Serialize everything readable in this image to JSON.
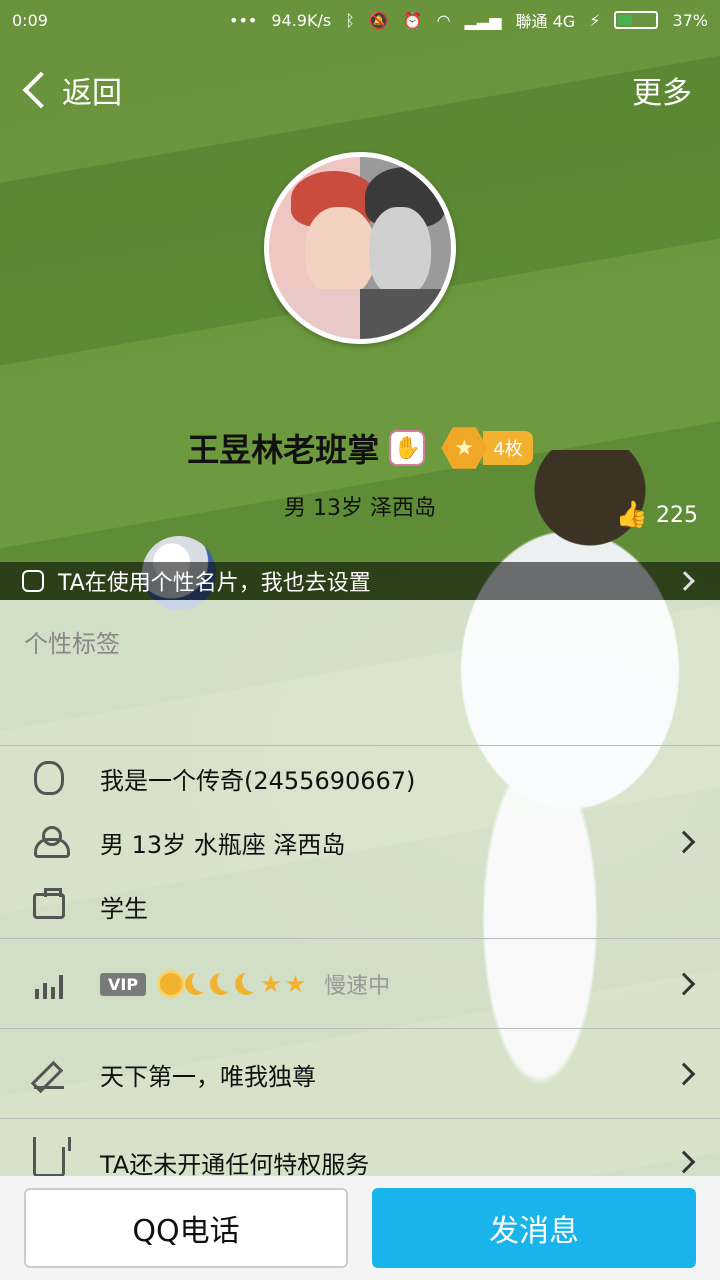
{
  "status_bar": {
    "time": "0:09",
    "speed": "94.9K/s",
    "carrier": "聯通 4G",
    "battery_pct": "37%",
    "battery_level": 0.37,
    "battery_color": "#4caf50"
  },
  "nav": {
    "back_label": "返回",
    "more_label": "更多"
  },
  "profile": {
    "name": "王昱林老班掌",
    "medal_count": "4枚",
    "summary": "男 13岁 泽西岛",
    "likes": "225"
  },
  "banner": {
    "text": "TA在使用个性名片，我也去设置"
  },
  "tags": {
    "title": "个性标签"
  },
  "info_rows": [
    {
      "icon": "qq-icon",
      "text": "我是一个传奇(2455690667)"
    },
    {
      "icon": "user-icon",
      "text": "男  13岁  水瓶座  泽西岛"
    },
    {
      "icon": "briefcase-icon",
      "text": "学生"
    }
  ],
  "vip_row": {
    "vip_badge": "VIP",
    "speed_text": "慢速中"
  },
  "signature_row": {
    "text": "天下第一，唯我独尊"
  },
  "privilege_row": {
    "text": "TA还未开通任何特权服务"
  },
  "actions": {
    "call_label": "QQ电话",
    "message_label": "发消息",
    "message_color": "#19b4ec"
  }
}
